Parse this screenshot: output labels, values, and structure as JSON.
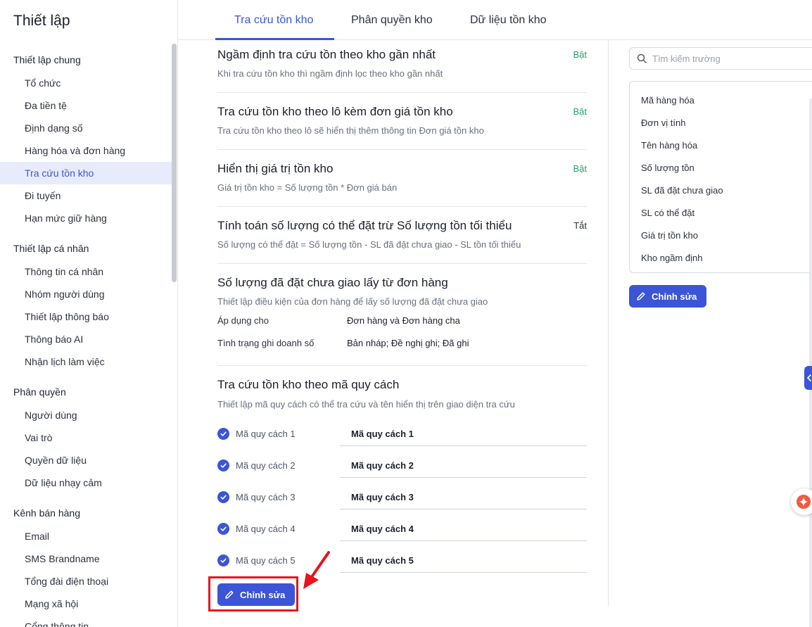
{
  "sidebar": {
    "title": "Thiết lập",
    "groups": [
      {
        "label": "Thiết lập chung",
        "items": [
          "Tổ chức",
          "Đa tiền tệ",
          "Định dạng số",
          "Hàng hóa và đơn hàng",
          "Tra cứu tồn kho",
          "Đi tuyến",
          "Hạn mức giữ hàng"
        ]
      },
      {
        "label": "Thiết lập cá nhân",
        "items": [
          "Thông tin cá nhân",
          "Nhóm người dùng",
          "Thiết lập thông báo",
          "Thông báo AI",
          "Nhận lịch làm việc"
        ]
      },
      {
        "label": "Phân quyền",
        "items": [
          "Người dùng",
          "Vai trò",
          "Quyền dữ liệu",
          "Dữ liệu nhạy cảm"
        ]
      },
      {
        "label": "Kênh bán hàng",
        "items": [
          "Email",
          "SMS Brandname",
          "Tổng đài điện thoại",
          "Mạng xã hội",
          "Cổng thông tin"
        ]
      }
    ],
    "active_item": "Tra cứu tồn kho"
  },
  "tabs": [
    "Tra cứu tồn kho",
    "Phân quyền kho",
    "Dữ liệu tồn kho"
  ],
  "active_tab": "Tra cứu tồn kho",
  "settings": [
    {
      "title": "Ngầm định tra cứu tồn theo kho gần nhất",
      "desc": "Khi tra cứu tồn kho thì ngầm định lọc theo kho gần nhất",
      "status": "Bật"
    },
    {
      "title": "Tra cứu tồn kho theo lô kèm đơn giá tồn kho",
      "desc": "Tra cứu tồn kho theo lô sẽ hiển thị thêm thông tin Đơn giá tồn kho",
      "status": "Bật"
    },
    {
      "title": "Hiển thị giá trị tồn kho",
      "desc": "Giá trị tồn kho = Số lượng tồn * Đơn giá bán",
      "status": "Bật"
    },
    {
      "title": "Tính toán số lượng có thể đặt trừ Số lượng tồn tối thiểu",
      "desc": "Số lượng có thể đặt = Số lượng tồn - SL đã đặt chưa giao - SL tồn tối thiểu",
      "status": "Tắt"
    }
  ],
  "pending": {
    "title": "Số lượng đã đặt chưa giao lấy từ đơn hàng",
    "desc": "Thiết lập điều kiện của đơn hàng để lấy số lượng đã đặt chưa giao",
    "apply_label": "Áp dụng cho",
    "apply_value": "Đơn hàng và Đơn hàng cha",
    "status_label": "Tình trạng ghi doanh số",
    "status_value": "Bản nháp; Đề nghị ghi; Đã ghi"
  },
  "spec": {
    "title": "Tra cứu tồn kho theo mã quy cách",
    "desc": "Thiết lập mã quy cách có thể tra cứu và tên hiển thị trên giao diện tra cứu",
    "rows": [
      {
        "label": "Mã quy cách 1",
        "value": "Mã quy cách 1"
      },
      {
        "label": "Mã quy cách 2",
        "value": "Mã quy cách 2"
      },
      {
        "label": "Mã quy cách 3",
        "value": "Mã quy cách 3"
      },
      {
        "label": "Mã quy cách 4",
        "value": "Mã quy cách 4"
      },
      {
        "label": "Mã quy cách 5",
        "value": "Mã quy cách 5"
      }
    ],
    "edit_label": "Chỉnh sửa"
  },
  "fields": {
    "search_placeholder": "Tìm kiếm trường",
    "items": [
      "Mã hàng hóa",
      "Đơn vị tính",
      "Tên hàng hóa",
      "Số lượng tồn",
      "SL đã đặt chưa giao",
      "SL có thể đặt",
      "Giá trị tồn kho",
      "Kho ngầm định"
    ],
    "edit_label": "Chỉnh sửa"
  },
  "colors": {
    "accent": "#3b55d6",
    "on": "#24a36b",
    "highlight": "#e8141b"
  }
}
